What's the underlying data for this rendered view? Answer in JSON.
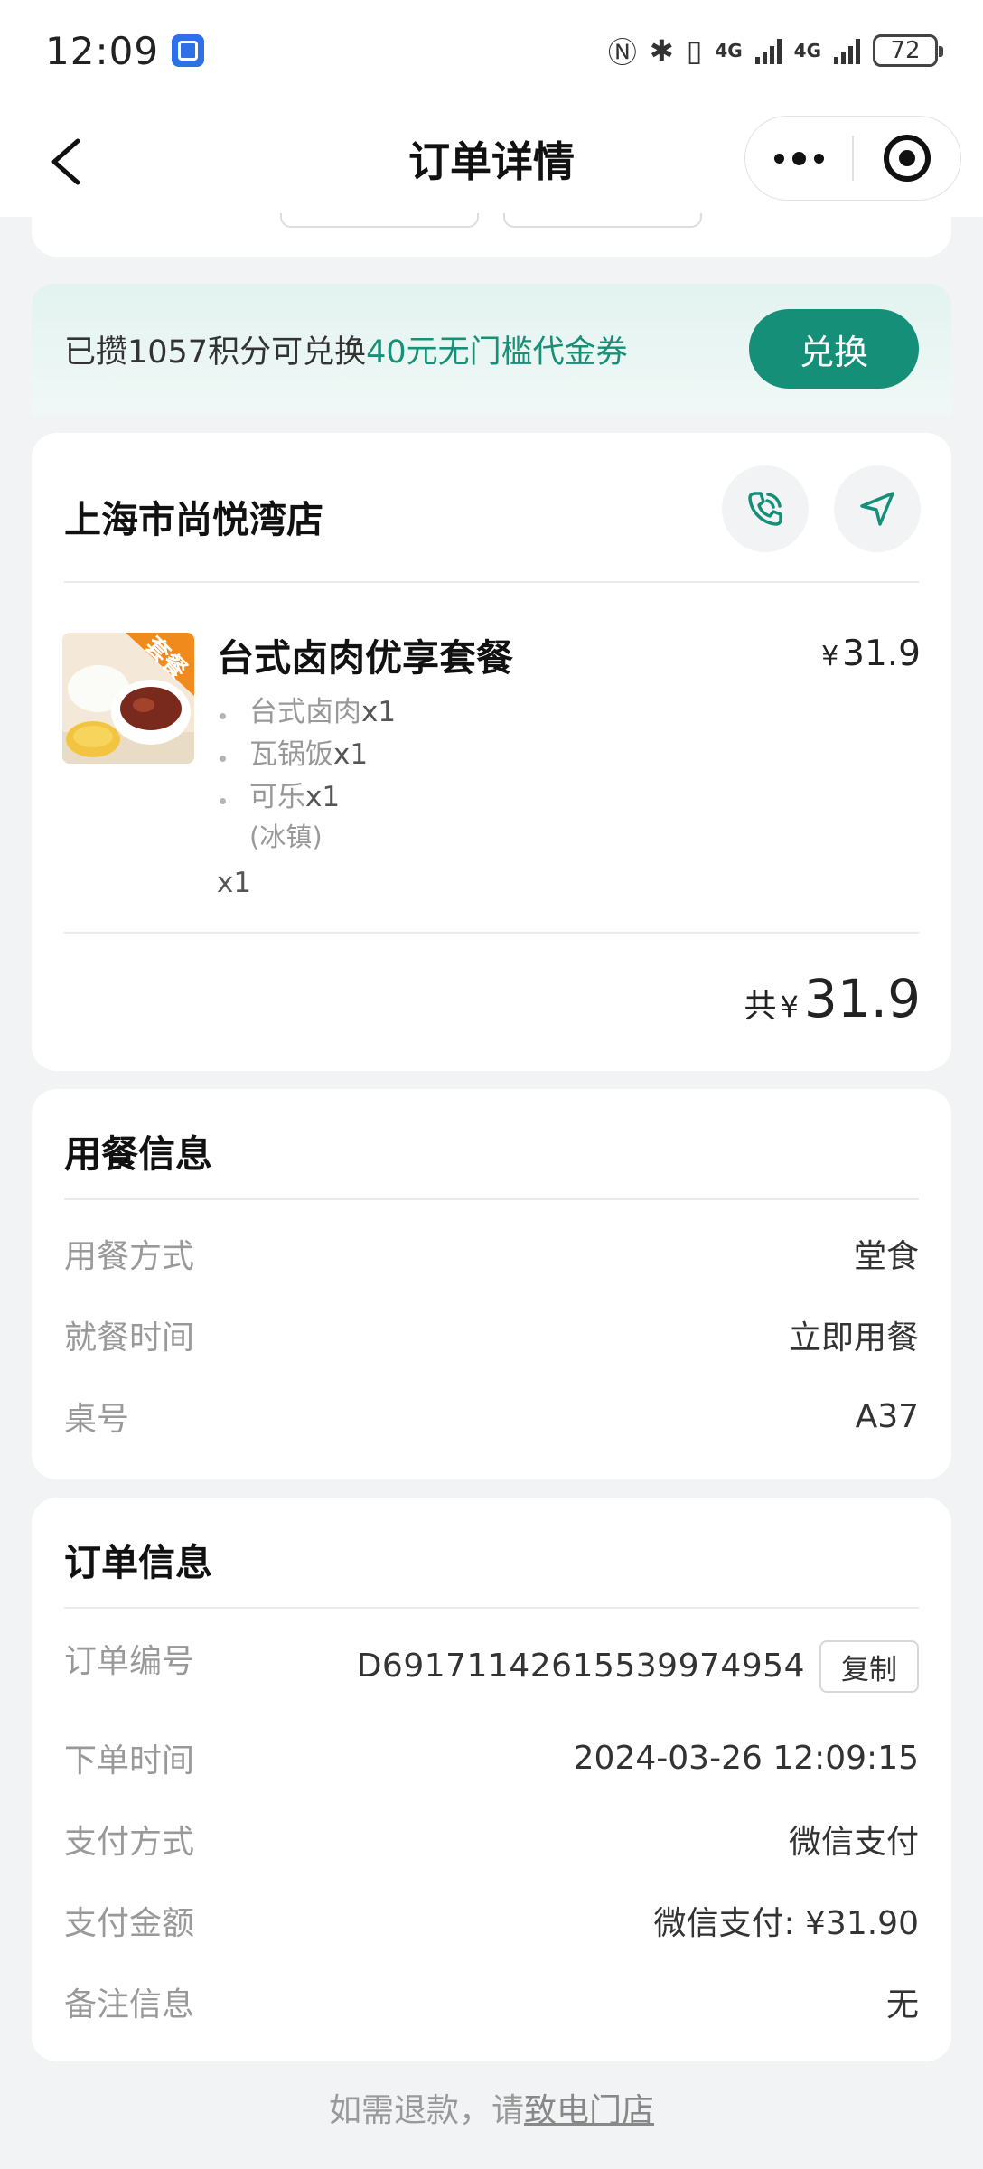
{
  "status_bar": {
    "time": "12:09",
    "network_left": "4G",
    "network_right": "4G",
    "battery": "72"
  },
  "nav": {
    "title": "订单详情"
  },
  "points_banner": {
    "text_prefix": "已攒1057积分可兑换",
    "text_highlight": "40元无门槛代金券",
    "button": "兑换",
    "highlight_color": "#179077"
  },
  "store": {
    "name": "上海市尚悦湾店",
    "product": {
      "name": "台式卤肉优享套餐",
      "badge": "套餐",
      "currency": "¥",
      "price": "31.9",
      "sub_items": [
        {
          "name": "台式卤肉",
          "qty": "x1"
        },
        {
          "name": "瓦锅饭",
          "qty": "x1"
        },
        {
          "name": "可乐",
          "qty": "x1",
          "note": "(冰镇)"
        }
      ],
      "quantity": "x1"
    },
    "total": {
      "label": "共",
      "currency": "¥",
      "value": "31.9"
    }
  },
  "dining_info": {
    "title": "用餐信息",
    "rows": [
      {
        "label": "用餐方式",
        "value": "堂食"
      },
      {
        "label": "就餐时间",
        "value": "立即用餐"
      },
      {
        "label": "桌号",
        "value": "A37"
      }
    ]
  },
  "order_info": {
    "title": "订单信息",
    "order_no_label": "订单编号",
    "order_no": "D6917114261553997495​4",
    "copy_button": "复制",
    "rows": [
      {
        "label": "下单时间",
        "value": "2024-03-26 12:09:15"
      },
      {
        "label": "支付方式",
        "value": "微信支付"
      },
      {
        "label": "支付金额",
        "value": "微信支付: ¥31.90"
      },
      {
        "label": "备注信息",
        "value": "无"
      }
    ]
  },
  "footer": {
    "prefix": "如需退款，请",
    "link": "致电门店"
  },
  "colors": {
    "brand_green": "#168f78",
    "page_bg": "#f2f3f5"
  }
}
